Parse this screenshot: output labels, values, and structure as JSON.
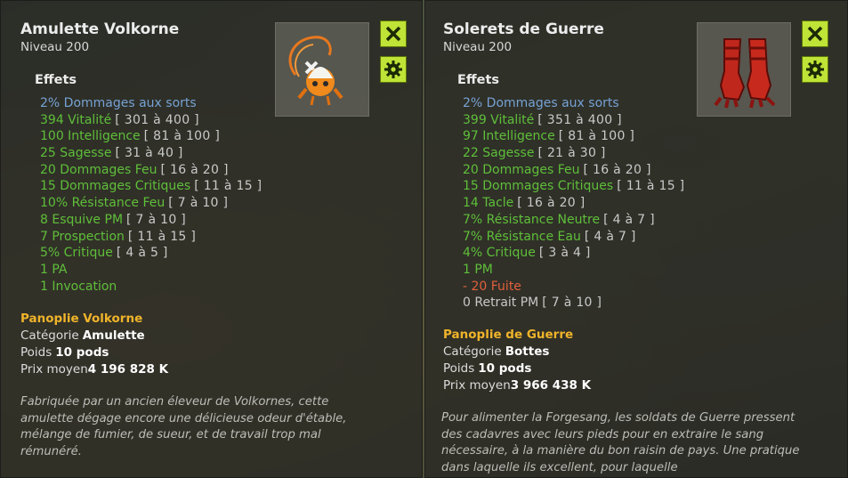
{
  "left": {
    "name": "Amulette Volkorne",
    "level": "Niveau  200",
    "effects_title": "Effets",
    "effects": [
      {
        "text": "2% Dommages aux sorts",
        "range": "",
        "color": "blue"
      },
      {
        "text": "394 Vitalité",
        "range": "[ 301 à 400 ]",
        "color": "green"
      },
      {
        "text": "100 Intelligence",
        "range": "[ 81 à 100 ]",
        "color": "green"
      },
      {
        "text": "25 Sagesse",
        "range": "[ 31 à 40 ]",
        "color": "green"
      },
      {
        "text": "20 Dommages Feu",
        "range": "[ 16 à 20 ]",
        "color": "green"
      },
      {
        "text": "15 Dommages Critiques",
        "range": "[ 11 à 15 ]",
        "color": "green"
      },
      {
        "text": "10% Résistance Feu",
        "range": "[ 7 à 10 ]",
        "color": "green"
      },
      {
        "text": "8 Esquive PM",
        "range": "[ 7 à 10 ]",
        "color": "green"
      },
      {
        "text": "7 Prospection",
        "range": "[ 11 à 15 ]",
        "color": "green"
      },
      {
        "text": "5% Critique",
        "range": "[ 4 à 5 ]",
        "color": "green"
      },
      {
        "text": "1 PA",
        "range": "",
        "color": "green"
      },
      {
        "text": "1 Invocation",
        "range": "",
        "color": "green"
      }
    ],
    "set_name": "Panoplie Volkorne",
    "category_label": "Catégorie",
    "category_value": "Amulette",
    "weight_label": "Poids",
    "weight_value": "10 pods",
    "price_label": "Prix moyen",
    "price_value": "4 196 828 K",
    "description": "Fabriquée par un ancien éleveur de Volkornes, cette amulette dégage encore une délicieuse odeur d'étable, mélange de fumier, de sueur, et de travail trop mal rémunéré."
  },
  "right": {
    "name": "Solerets de Guerre",
    "level": "Niveau  200",
    "effects_title": "Effets",
    "effects": [
      {
        "text": "2% Dommages aux sorts",
        "range": "",
        "color": "blue"
      },
      {
        "text": "399 Vitalité",
        "range": "[ 351 à 400 ]",
        "color": "green"
      },
      {
        "text": "97 Intelligence",
        "range": "[ 81 à 100 ]",
        "color": "green"
      },
      {
        "text": "22 Sagesse",
        "range": "[ 21 à 30 ]",
        "color": "green"
      },
      {
        "text": "20 Dommages Feu",
        "range": "[ 16 à 20 ]",
        "color": "green"
      },
      {
        "text": "15 Dommages Critiques",
        "range": "[ 11 à 15 ]",
        "color": "green"
      },
      {
        "text": "14 Tacle",
        "range": "[ 16 à 20 ]",
        "color": "green"
      },
      {
        "text": "7% Résistance Neutre",
        "range": "[ 4 à 7 ]",
        "color": "green"
      },
      {
        "text": "7% Résistance Eau",
        "range": "[ 4 à 7 ]",
        "color": "green"
      },
      {
        "text": "4% Critique",
        "range": "[ 3 à 4 ]",
        "color": "green"
      },
      {
        "text": "1 PM",
        "range": "",
        "color": "green"
      },
      {
        "text": "- 20 Fuite",
        "range": "",
        "color": "red"
      },
      {
        "text": "0 Retrait PM",
        "range": "[ 7 à 10 ]",
        "color": "grey"
      }
    ],
    "set_name": "Panoplie de Guerre",
    "category_label": "Catégorie",
    "category_value": "Bottes",
    "weight_label": "Poids",
    "weight_value": "10 pods",
    "price_label": "Prix moyen",
    "price_value": "3 966 438 K",
    "description": "Pour alimenter la Forgesang, les soldats de Guerre pressent des cadavres avec leurs pieds pour en extraire le sang nécessaire, à la manière du bon raisin de pays. Une pratique dans laquelle ils excellent, pour laquelle"
  },
  "icons": {
    "close": "close-icon",
    "settings": "gear-icon",
    "left_item": "amulet-icon",
    "right_item": "boots-icon"
  },
  "colors": {
    "accent_button": "#bfe336",
    "set_name": "#f0b42a",
    "effect_blue": "#76a2d4",
    "effect_green": "#5fbf3a",
    "effect_red": "#e0603c"
  }
}
